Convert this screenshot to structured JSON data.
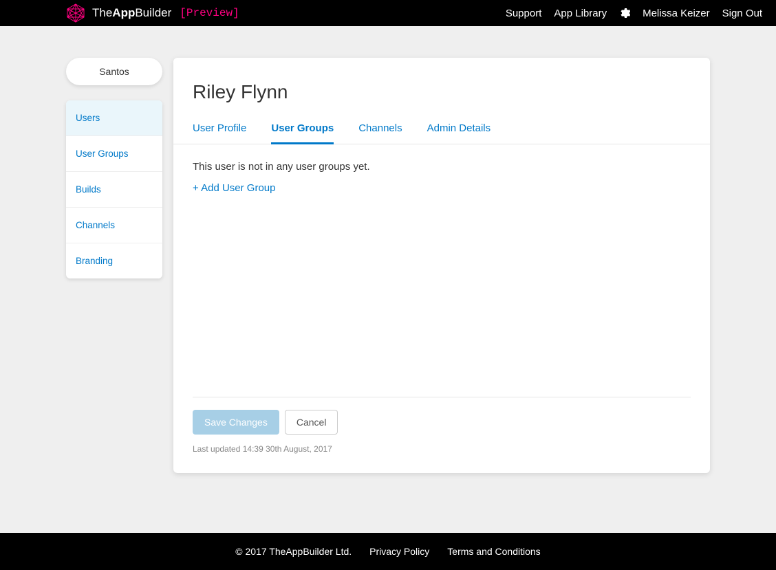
{
  "header": {
    "brand_the": "The",
    "brand_app": "App",
    "brand_builder": "Builder",
    "preview": "[Preview]",
    "nav": {
      "support": "Support",
      "app_library": "App Library",
      "user_name": "Melissa Keizer",
      "sign_out": "Sign Out"
    }
  },
  "sidebar": {
    "project_name": "Santos",
    "items": [
      {
        "label": "Users",
        "active": true
      },
      {
        "label": "User Groups",
        "active": false
      },
      {
        "label": "Builds",
        "active": false
      },
      {
        "label": "Channels",
        "active": false
      },
      {
        "label": "Branding",
        "active": false
      }
    ]
  },
  "main": {
    "title": "Riley Flynn",
    "tabs": [
      {
        "label": "User Profile",
        "active": false
      },
      {
        "label": "User Groups",
        "active": true
      },
      {
        "label": "Channels",
        "active": false
      },
      {
        "label": "Admin Details",
        "active": false
      }
    ],
    "empty_message": "This user is not in any user groups yet.",
    "add_link": "+ Add User Group",
    "save_label": "Save Changes",
    "cancel_label": "Cancel",
    "last_updated": "Last updated 14:39 30th August, 2017"
  },
  "footer": {
    "copyright": "© 2017 TheAppBuilder Ltd.",
    "privacy": "Privacy Policy",
    "terms": "Terms and Conditions"
  }
}
